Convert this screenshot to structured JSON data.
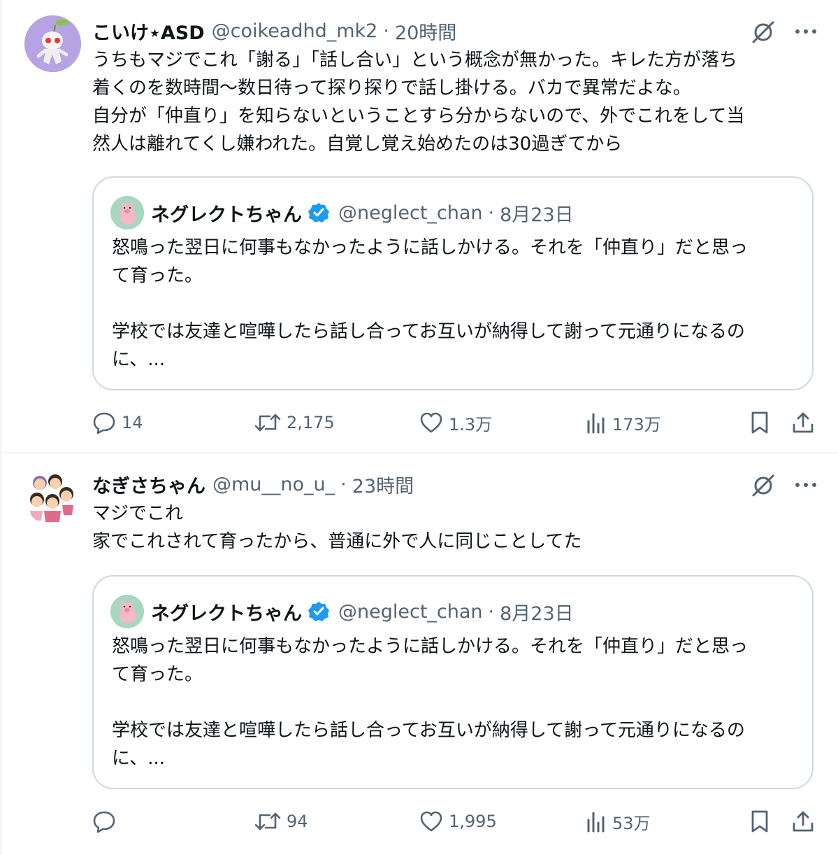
{
  "tweets": [
    {
      "author": {
        "name": "こいけ⋆ASD",
        "handle": "@coikeadhd_mk2"
      },
      "separator": "·",
      "time": "20時間",
      "body": [
        "うちもマジでこれ「謝る」「話し合い」という概念が無かった。キレた方が落ち",
        "着くのを数時間〜数日待って探り探りで話し掛ける。バカで異常だよな。",
        "自分が「仲直り」を知らないということすら分からないので、外でこれをして当",
        "然人は離れてくし嫌われた。自覚し覚え始めたのは30過ぎてから"
      ],
      "quote": {
        "name": "ネグレクトちゃん",
        "handle": "@neglect_chan",
        "separator": "·",
        "date": "8月23日",
        "line1": "怒鳴った翌日に何事もなかったように話しかける。それを「仲直り」だと思っ",
        "line2": "て育った。",
        "line3": "学校では友達と喧嘩したら話し合ってお互いが納得して謝って元通りになるの",
        "line4": "に、..."
      },
      "stats": {
        "replies": "14",
        "retweets": "2,175",
        "likes": "1.3万",
        "views": "173万"
      }
    },
    {
      "author": {
        "name": "なぎさちゃん",
        "handle": "@mu__no_u_"
      },
      "separator": "·",
      "time": "23時間",
      "body": [
        "マジでこれ",
        "家でこれされて育ったから、普通に外で人に同じことしてた"
      ],
      "quote": {
        "name": "ネグレクトちゃん",
        "handle": "@neglect_chan",
        "separator": "·",
        "date": "8月23日",
        "line1": "怒鳴った翌日に何事もなかったように話しかける。それを「仲直り」だと思っ",
        "line2": "て育った。",
        "line3": "学校では友達と喧嘩したら話し合ってお互いが納得して謝って元通りになるの",
        "line4": "に、..."
      },
      "stats": {
        "replies": "",
        "retweets": "94",
        "likes": "1,995",
        "views": "53万"
      }
    }
  ],
  "colors": {
    "text": "#0f1419",
    "muted": "#536471",
    "border": "#cfd9de",
    "verified": "#1d9bf0",
    "divider": "#eff3f4"
  },
  "icons": [
    "grok-icon",
    "more-icon",
    "verified-badge-icon",
    "reply-icon",
    "retweet-icon",
    "like-icon",
    "views-icon",
    "bookmark-icon",
    "share-icon"
  ]
}
